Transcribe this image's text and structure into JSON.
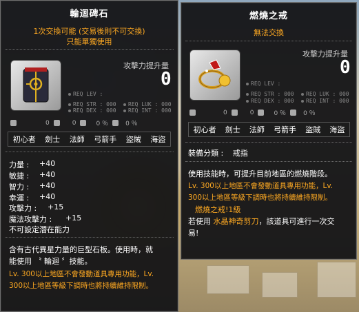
{
  "left": {
    "title": "輪迴碑石",
    "trade1": "1次交換可能 (交易後則不可交換)",
    "trade2": "只能單獨使用",
    "power_label": "攻擊力提升量",
    "power_value": "0",
    "req": {
      "lev": "REQ LEV : ",
      "str": "REQ STR : 000",
      "luk": "REQ LUK : 000",
      "dex": "REQ DEX : 000",
      "int": "REQ INT : 000"
    },
    "row_a": "0",
    "row_b": "0",
    "row_c": "0 ％",
    "row_d": "0 ％",
    "jobs": [
      "初心者",
      "劍士",
      "法師",
      "弓箭手",
      "盜賊",
      "海盜"
    ],
    "stats": [
      {
        "label": "力量 :",
        "value": "+40"
      },
      {
        "label": "敏捷 :",
        "value": "+40"
      },
      {
        "label": "智力 :",
        "value": "+40"
      },
      {
        "label": "幸運 :",
        "value": "+40"
      },
      {
        "label": "攻擊力 :",
        "value": "+15"
      },
      {
        "label": "魔法攻擊力 :",
        "value": "+15"
      }
    ],
    "no_potential": "不可設定潛在能力",
    "desc1": "含有古代異星力量的巨型石板。使用時，就",
    "desc2": "能使用 〝 輪迴 〞技能。",
    "desc3": "Lv. 300以上地區不會發動道具專用功能，Lv.",
    "desc4": "300以上地區等級下調時也將持續維持限制。"
  },
  "right": {
    "title": "燃燒之戒",
    "trade": "無法交換",
    "power_label": "攻擊力提升量",
    "power_value": "0",
    "req": {
      "lev": "REQ LEV : ",
      "str": "REQ STR : 000",
      "luk": "REQ LUK : 000",
      "dex": "REQ DEX : 000",
      "int": "REQ INT : 000"
    },
    "row_a": "0",
    "row_b": "0",
    "row_c": "0 ％",
    "row_d": "0 ％",
    "jobs": [
      "初心者",
      "劍士",
      "法師",
      "弓箭手",
      "盜賊",
      "海盜"
    ],
    "category_label": "裝備分類 :",
    "category_value": "戒指",
    "desc1": "使用技能時，可提升目前地區的燃燒階段。",
    "desc2": "Lv. 300以上地區不會發動道具專用功能，Lv.",
    "desc3": "300以上地區等級下調時也將持續維持限制。",
    "desc4": "燃燒之戒!1級",
    "desc5_a": "若使用 ",
    "desc5_b": "水晶神奇剪刀",
    "desc5_c": "，該道具可進行一次交",
    "desc6": "易!"
  },
  "colors": {
    "orange": "#ffaa22",
    "panel": "#161618"
  }
}
